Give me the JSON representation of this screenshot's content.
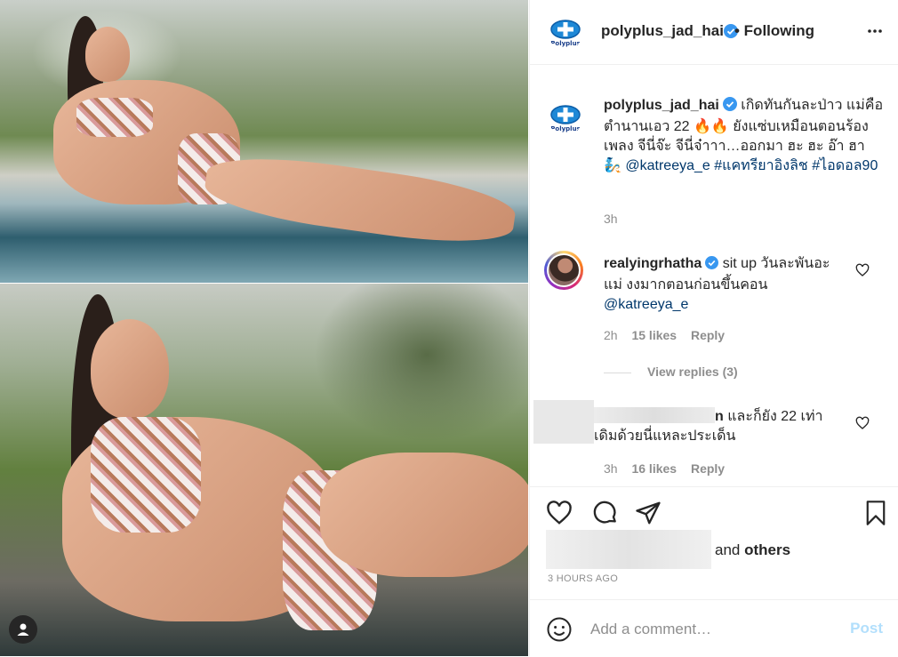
{
  "post": {
    "username": "polyplus_jad_hai",
    "following_label": "• Following",
    "brand_logo_text": "Polyplus",
    "caption_text": "เกิดทันกันละป่าว แม่คือตำนานเอว 22 🔥🔥 ยังแซ่บเหมือนตอนร้องเพลง จีนี่จ๊ะ จีนี่จ๋าาา…ออกมา ฮะ ฮะ อ๊า ฮา 🧞",
    "caption_mention": "@katreeya_e",
    "caption_tag1": "#แคทรียาอิงลิช",
    "caption_tag2": "#ไอดอล90",
    "caption_time": "3h"
  },
  "comments": [
    {
      "username": "realyingrhatha",
      "text": "sit up วันละพันอะแม่ งงมากตอนก่อนขึ้นคอน",
      "mention": "@katreeya_e",
      "time": "2h",
      "likes": "15 likes",
      "reply_label": "Reply",
      "view_replies": "View replies (3)"
    },
    {
      "username_suffix": "n",
      "text": "และก็ยัง 22 เท่าเดิมด้วยนี่แหละประเด็น",
      "time": "3h",
      "likes": "16 likes",
      "reply_label": "Reply"
    }
  ],
  "footer": {
    "likes_and": "and ",
    "likes_others": "others",
    "time_ago": "3 HOURS AGO",
    "add_comment_placeholder": "Add a comment…",
    "post_label": "Post"
  },
  "colors": {
    "verified_blue": "#3897f0",
    "link_blue": "#00376b",
    "post_disabled": "#b2dffc",
    "brand_blue": "#1e88d6"
  }
}
